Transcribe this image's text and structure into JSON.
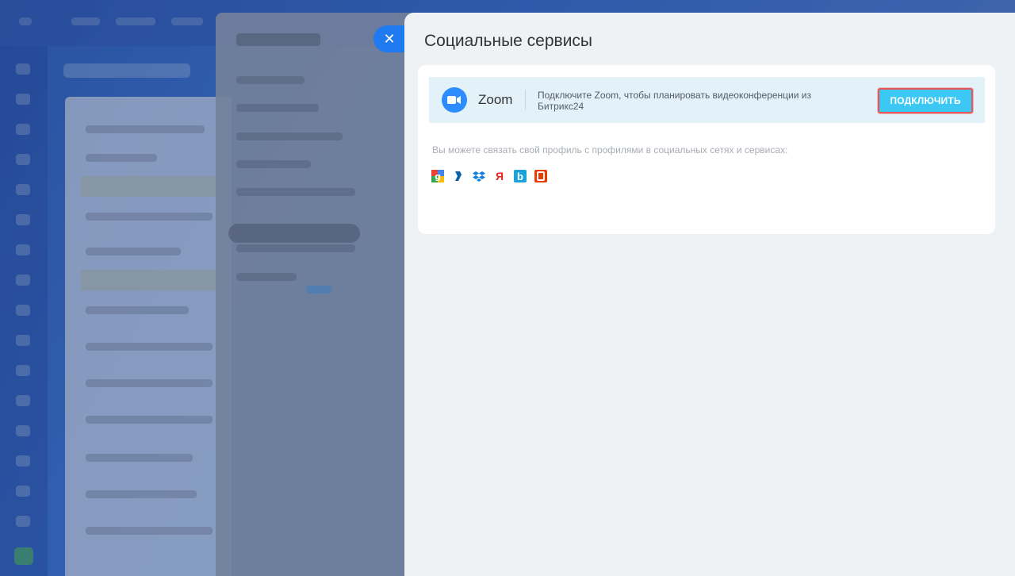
{
  "slider": {
    "title": "Социальные сервисы"
  },
  "zoom": {
    "name": "Zoom",
    "description": "Подключите Zoom, чтобы планировать видеоконференции из Битрикс24",
    "connect_label": "ПОДКЛЮЧИТЬ",
    "logo_color": "#2d8cff"
  },
  "social": {
    "text": "Вы можете связать свой профиль с профилями в социальных сетях и сервисах:",
    "services": [
      {
        "icon": "google-icon",
        "glyph": "g",
        "color": "#34a853"
      },
      {
        "icon": "liveid-icon",
        "glyph": "l",
        "color": "#0b5ea8"
      },
      {
        "icon": "dropbox-icon",
        "glyph": "✦",
        "color": "#0d7fe0"
      },
      {
        "icon": "yandex-icon",
        "glyph": "Я",
        "color": "#e52620"
      },
      {
        "icon": "box-icon",
        "glyph": "b",
        "color": "#1aa3d9"
      },
      {
        "icon": "office365-icon",
        "glyph": "O",
        "color": "#eb3c00"
      }
    ]
  },
  "colors": {
    "accent_blue": "#1f7af0",
    "connect_button": "#3bc8f5",
    "highlight_border": "#e8565a"
  }
}
